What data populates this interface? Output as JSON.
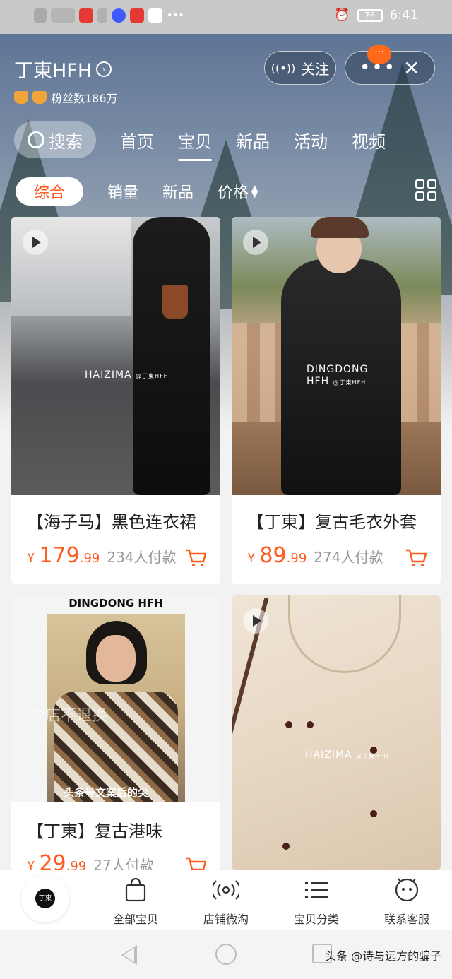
{
  "status_bar": {
    "time": "6:41",
    "battery": "76"
  },
  "header": {
    "shop_name": "丁東HFH",
    "fans": "粉丝数186万",
    "follow_label": "关注",
    "more_glyph": "•••",
    "close_glyph": "✕",
    "badge_glyph": "···"
  },
  "tabs": {
    "search_label": "搜索",
    "items": [
      "首页",
      "宝贝",
      "新品",
      "活动",
      "视频"
    ],
    "active": "宝贝"
  },
  "filters": {
    "items": [
      "综合",
      "销量",
      "新品",
      "价格"
    ],
    "active": "综合"
  },
  "products": [
    {
      "title": "【海子马】黑色连衣裙",
      "yen": "¥",
      "price_int": "179",
      "price_dec": ".99",
      "paid": "234人付款",
      "watermark": "HAIZIMA",
      "watermark_small": "@丁東HFH",
      "has_video": true
    },
    {
      "title": "【丁東】复古毛衣外套",
      "yen": "¥",
      "price_int": "89",
      "price_dec": ".99",
      "paid": "274人付款",
      "watermark": "DINGDONG",
      "watermark2": "HFH",
      "watermark_small": "@丁東HFH",
      "has_video": true
    },
    {
      "title": "【丁東】复古港味",
      "yen": "¥",
      "price_int": "29",
      "price_dec": ".99",
      "paid": "27人付款",
      "brand_header": "DINGDONG HFH",
      "caption": "今店不退换",
      "caption2": "头条号文案后的尖",
      "has_video": false
    },
    {
      "title": "",
      "watermark": "HAIZIMA",
      "watermark_small": "@丁東HFH",
      "has_video": true
    }
  ],
  "shop_bar": {
    "logo_text": "丁東",
    "items": [
      {
        "label": "全部宝贝",
        "icon": "shopping-bag-icon"
      },
      {
        "label": "店铺微淘",
        "icon": "broadcast-icon"
      },
      {
        "label": "宝贝分类",
        "icon": "list-icon"
      },
      {
        "label": "联系客服",
        "icon": "chat-bubble-icon"
      }
    ]
  },
  "watermark_credit": "头条 @诗与远方的骗子",
  "colors": {
    "accent": "#ff5a1f",
    "badge": "#ff6a1a"
  }
}
